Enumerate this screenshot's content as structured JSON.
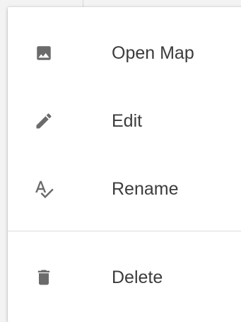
{
  "menu": {
    "items": [
      {
        "label": "Open Map",
        "icon": "image-icon"
      },
      {
        "label": "Edit",
        "icon": "pencil-icon"
      },
      {
        "label": "Rename",
        "icon": "spellcheck-icon"
      },
      {
        "label": "Delete",
        "icon": "trash-icon"
      }
    ]
  },
  "colors": {
    "icon": "#6b6b6b",
    "text": "#3c3c3c",
    "divider": "#dcdcdc"
  }
}
